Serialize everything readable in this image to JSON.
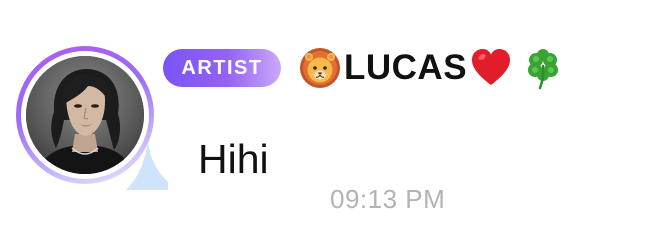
{
  "sender": {
    "badge_label": "ARTIST",
    "name": "LUCAS",
    "name_prefix_icon": "lion-face-emoji",
    "name_suffix_icons": [
      "red-heart-emoji",
      "four-leaf-clover-emoji"
    ],
    "avatar": "profile-photo"
  },
  "message": {
    "text": "Hihi",
    "time": "09:13 PM"
  },
  "colors": {
    "badge_gradient_start": "#7a54f4",
    "badge_gradient_end": "#c9a9f9",
    "avatar_ring": "#9a6bf6",
    "bubble_tail": "#cfe4fb",
    "timestamp": "#b3b3b3"
  }
}
